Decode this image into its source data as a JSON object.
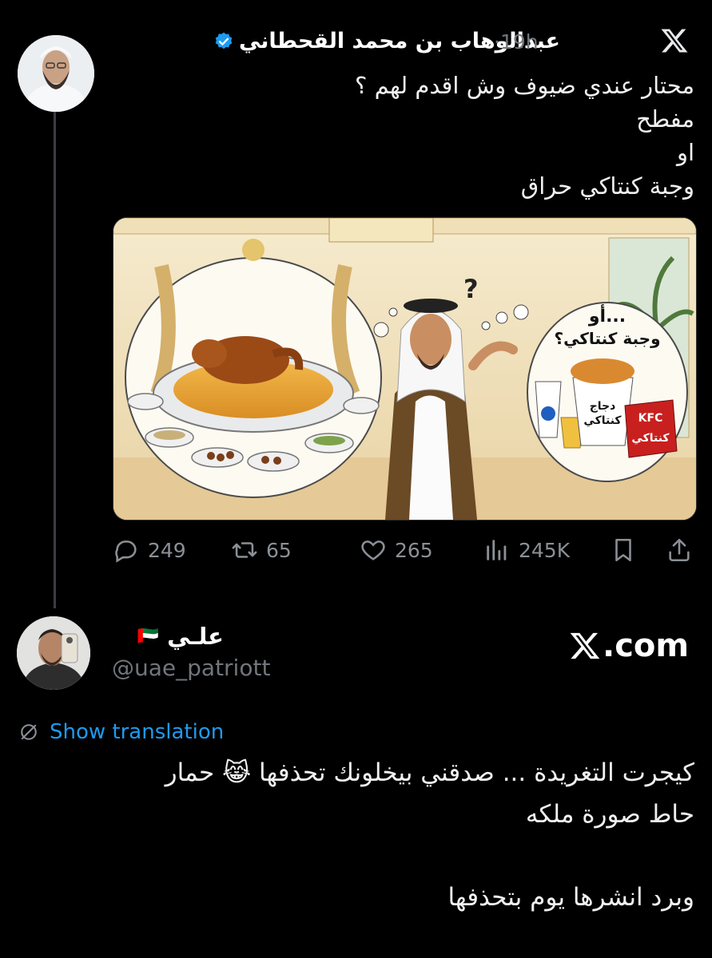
{
  "tweet": {
    "author_name": "عبدالوهاب بن محمد القحطاني",
    "time": "·19h",
    "lines": [
      "محتار عندي ضيوف وش اقدم لهم ؟",
      "مفطح",
      "او",
      "وجبة كنتاكي حراق"
    ],
    "image": {
      "bubble_right_title": "أو...",
      "bubble_right_subtitle": "وجبة كنتاكي؟",
      "question_mark": "?",
      "bucket_label_line1": "دجاج",
      "bucket_label_line2": "كنتاكي",
      "box_brand": "KFC",
      "box_label": "كنتاكي"
    },
    "actions": {
      "replies": "249",
      "reposts": "65",
      "likes": "265",
      "views": "245K"
    }
  },
  "reply": {
    "author_name": "علـي",
    "flag": "🇦🇪",
    "handle": "@uae_patriott",
    "watermark": ".com",
    "show_translation": "Show translation",
    "lines": [
      "كيجرت التغريدة ... صدقني بيخلونك تحذفها 😹 حمار",
      "حاط صورة ملكه",
      "",
      "وبرد انشرها يوم بتحذفها"
    ]
  },
  "colors": {
    "accent": "#1d9bf0",
    "muted": "#71767b",
    "background": "#000000"
  }
}
